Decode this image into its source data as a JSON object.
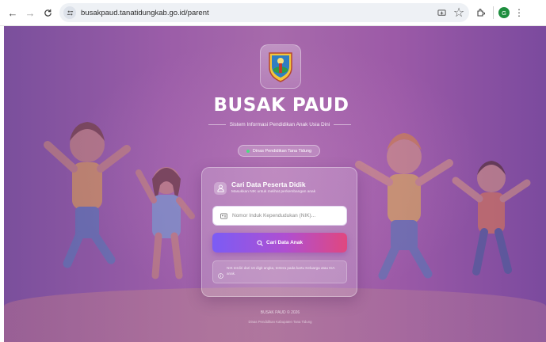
{
  "browser": {
    "url": "busakpaud.tanatidungkab.go.id/parent",
    "profile_initial": "G"
  },
  "header": {
    "title": "BUSAK PAUD",
    "subtitle": "Sistem Informasi Pendidikan Anak Usia Dini",
    "badge": "Dinas Pendidikan Tana Tidung"
  },
  "card": {
    "title": "Cari Data Peserta Didik",
    "description": "Masukkan NIK untuk melihat perkembangan anak",
    "nik_placeholder": "Nomor Induk Kependudukan (NIK)...",
    "nik_value": "",
    "search_label": "Cari Data Anak",
    "info_text": "NIK terdiri dari 16 digit angka, tertera pada kartu Keluarga atau KIA anak."
  },
  "footer": {
    "line1": "BUSAK PAUD © 2026",
    "line2": "Dinas Pendidikan Kabupaten Tana Tidung"
  },
  "colors": {
    "background": "#9b5da8",
    "button_start": "#7b5cf5",
    "button_end": "#e0477f",
    "badge_dot": "#4ade80",
    "profile": "#1e8e3e"
  }
}
